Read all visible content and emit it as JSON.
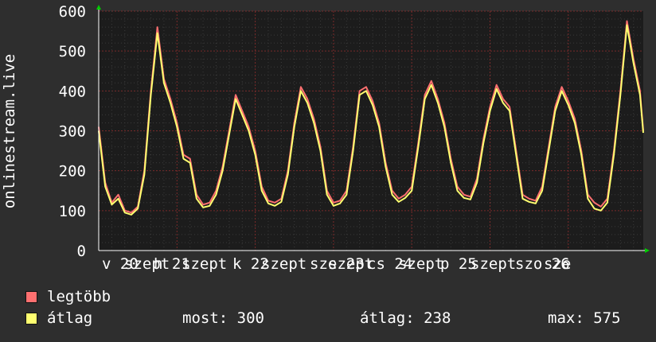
{
  "colors": {
    "background": "#2e2e2e",
    "plot_background": "#1c1c1c",
    "grid_minor": "#3a3a3a",
    "grid_major": "#7a2a2a",
    "axis_arrow": "#00cc00",
    "series_max": "#ff7070",
    "series_avg": "#ffff70"
  },
  "chart_data": {
    "type": "line",
    "ylabel": "onlinestream.live",
    "ylim": [
      0,
      600
    ],
    "yticks": [
      "0",
      "100",
      "200",
      "300",
      "400",
      "500",
      "600"
    ],
    "xlabels": [
      "v 20",
      "szept",
      "h 21",
      "szept",
      "k 22",
      "szept",
      "sze 23",
      "szept",
      "cs 24",
      "szept",
      "p 25",
      "szept",
      "szo 26",
      "sze"
    ],
    "grid": true,
    "series": [
      {
        "name": "legtöbb",
        "color": "#ff7070",
        "x": [
          0,
          2,
          4,
          6,
          8,
          10,
          12,
          14,
          16,
          18,
          20,
          22,
          24,
          26,
          28,
          30,
          32,
          34,
          36,
          38,
          40,
          42,
          44,
          46,
          48,
          50,
          52,
          54,
          56,
          58,
          60,
          62,
          64,
          66,
          68,
          70,
          72,
          74,
          76,
          78,
          80,
          82,
          84,
          86,
          88,
          90,
          92,
          94,
          96,
          98,
          100,
          102,
          104,
          106,
          108,
          110,
          112,
          114,
          116,
          118,
          120,
          122,
          124,
          126,
          128,
          130,
          132,
          134,
          136,
          138,
          140,
          142,
          144,
          146,
          148,
          150,
          152,
          154,
          156,
          158,
          160,
          162,
          164,
          166,
          167
        ],
        "values": [
          310,
          170,
          120,
          140,
          100,
          95,
          110,
          200,
          400,
          560,
          430,
          380,
          320,
          240,
          230,
          140,
          115,
          120,
          150,
          210,
          300,
          390,
          350,
          310,
          250,
          160,
          125,
          120,
          130,
          200,
          320,
          410,
          380,
          330,
          260,
          150,
          120,
          125,
          150,
          260,
          400,
          410,
          375,
          320,
          220,
          150,
          130,
          140,
          160,
          270,
          390,
          425,
          380,
          320,
          230,
          160,
          140,
          135,
          180,
          280,
          360,
          415,
          380,
          360,
          250,
          140,
          130,
          125,
          160,
          260,
          360,
          410,
          375,
          330,
          250,
          140,
          120,
          110,
          130,
          250,
          400,
          575,
          480,
          400,
          300
        ]
      },
      {
        "name": "átlag",
        "color": "#ffff70",
        "x": [
          0,
          2,
          4,
          6,
          8,
          10,
          12,
          14,
          16,
          18,
          20,
          22,
          24,
          26,
          28,
          30,
          32,
          34,
          36,
          38,
          40,
          42,
          44,
          46,
          48,
          50,
          52,
          54,
          56,
          58,
          60,
          62,
          64,
          66,
          68,
          70,
          72,
          74,
          76,
          78,
          80,
          82,
          84,
          86,
          88,
          90,
          92,
          94,
          96,
          98,
          100,
          102,
          104,
          106,
          108,
          110,
          112,
          114,
          116,
          118,
          120,
          122,
          124,
          126,
          128,
          130,
          132,
          134,
          136,
          138,
          140,
          142,
          144,
          146,
          148,
          150,
          152,
          154,
          156,
          158,
          160,
          162,
          164,
          166,
          167
        ],
        "values": [
          300,
          160,
          115,
          130,
          95,
          90,
          105,
          190,
          390,
          545,
          420,
          370,
          310,
          230,
          220,
          130,
          108,
          112,
          140,
          200,
          290,
          380,
          340,
          300,
          240,
          150,
          118,
          112,
          122,
          190,
          310,
          400,
          370,
          320,
          250,
          140,
          112,
          118,
          140,
          250,
          390,
          400,
          365,
          310,
          210,
          140,
          122,
          132,
          150,
          260,
          380,
          415,
          370,
          310,
          220,
          150,
          132,
          128,
          170,
          270,
          350,
          405,
          370,
          350,
          240,
          130,
          122,
          118,
          150,
          250,
          350,
          400,
          365,
          320,
          240,
          130,
          105,
          100,
          120,
          240,
          390,
          565,
          470,
          390,
          295
        ]
      }
    ]
  },
  "legend": {
    "items": [
      {
        "label": "legtöbb",
        "color": "#ff7070"
      },
      {
        "label": "átlag",
        "color": "#ffff70"
      }
    ],
    "stats": {
      "now": "most: 300",
      "avg": "átlag: 238",
      "max": "max: 575"
    }
  }
}
